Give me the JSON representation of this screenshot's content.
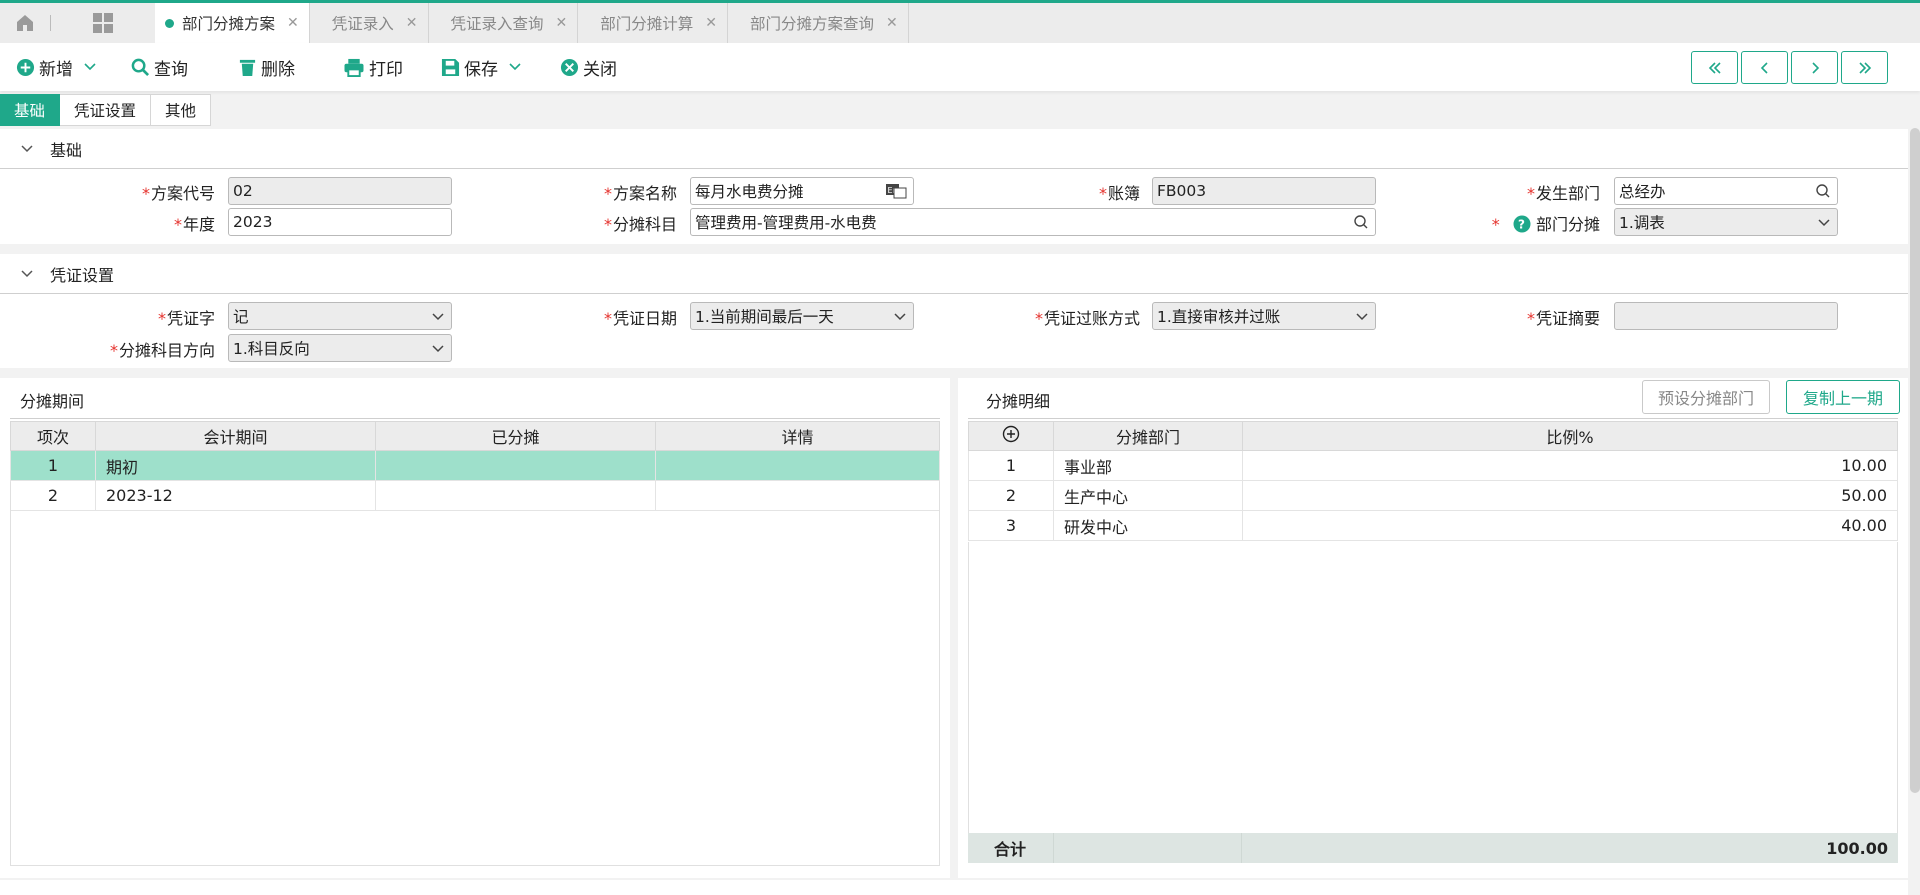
{
  "tabs": [
    {
      "label": "部门分摊方案",
      "active": true
    },
    {
      "label": "凭证录入",
      "active": false
    },
    {
      "label": "凭证录入查询",
      "active": false
    },
    {
      "label": "部门分摊计算",
      "active": false
    },
    {
      "label": "部门分摊方案查询",
      "active": false
    }
  ],
  "toolbar": {
    "new_label": "新增",
    "query_label": "查询",
    "delete_label": "删除",
    "print_label": "打印",
    "save_label": "保存",
    "close_label": "关闭"
  },
  "subtabs": [
    "基础",
    "凭证设置",
    "其他"
  ],
  "basic": {
    "title": "基础",
    "scheme_code_label": "方案代号",
    "scheme_code": "02",
    "scheme_name_label": "方案名称",
    "scheme_name": "每月水电费分摊",
    "ledger_label": "账簿",
    "ledger": "FB003",
    "source_dept_label": "发生部门",
    "source_dept": "总经办",
    "year_label": "年度",
    "year": "2023",
    "account_label": "分摊科目",
    "account": "管理费用-管理费用-水电费",
    "dept_alloc_label": "部门分摊",
    "dept_alloc": "1.调表"
  },
  "voucher": {
    "title": "凭证设置",
    "word_label": "凭证字",
    "word": "记",
    "date_label": "凭证日期",
    "date": "1.当前期间最后一天",
    "posting_label": "凭证过账方式",
    "posting": "1.直接审核并过账",
    "summary_label": "凭证摘要",
    "summary": "",
    "direction_label": "分摊科目方向",
    "direction": "1.科目反向"
  },
  "periods": {
    "title": "分摊期间",
    "columns": [
      "项次",
      "会计期间",
      "已分摊",
      "详情"
    ],
    "rows": [
      {
        "no": "1",
        "period": "期初",
        "allocated": "",
        "detail": ""
      },
      {
        "no": "2",
        "period": "2023-12",
        "allocated": "",
        "detail": ""
      }
    ]
  },
  "details": {
    "title": "分摊明细",
    "preset_button": "预设分摊部门",
    "copy_button": "复制上一期",
    "columns": [
      "分摊部门",
      "比例%"
    ],
    "rows": [
      {
        "no": "1",
        "dept": "事业部",
        "ratio": "10.00"
      },
      {
        "no": "2",
        "dept": "生产中心",
        "ratio": "50.00"
      },
      {
        "no": "3",
        "dept": "研发中心",
        "ratio": "40.00"
      }
    ],
    "total_label": "合计",
    "total": "100.00"
  },
  "colors": {
    "accent": "#1fa88a",
    "required": "#e5322d",
    "selected_row": "#9ee0cb"
  }
}
